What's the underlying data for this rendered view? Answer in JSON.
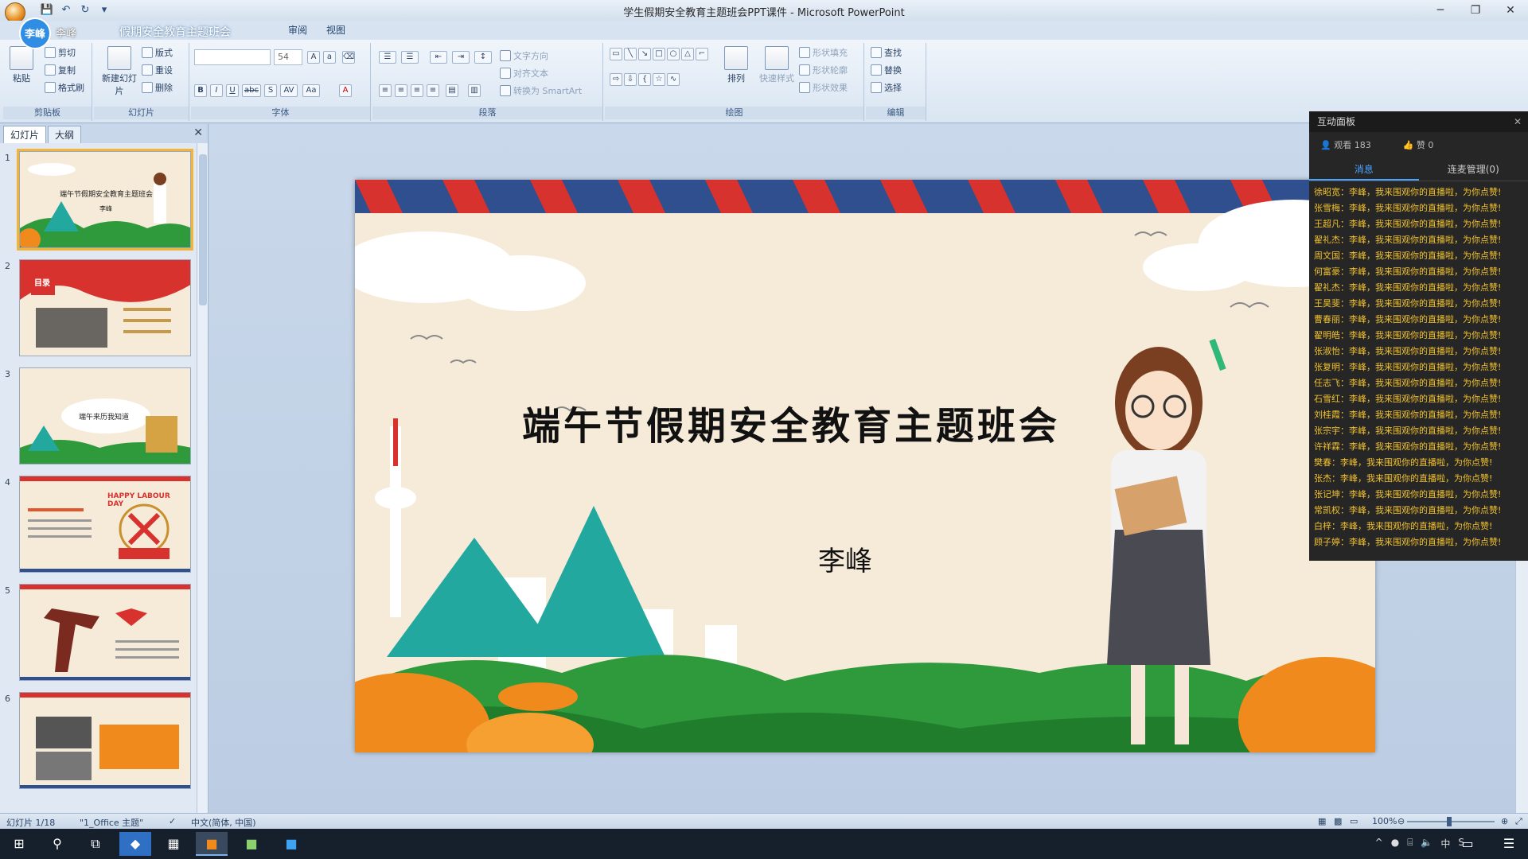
{
  "window": {
    "title": "学生假期安全教育主题班会PPT课件 - Microsoft PowerPoint",
    "min": "─",
    "max": "❐",
    "close": "✕"
  },
  "user": {
    "badge": "李峰",
    "name": "李峰"
  },
  "doc_tab_title": "假期安全教育主题班会",
  "ribbon_tabs": [
    "审阅",
    "视图"
  ],
  "ribbon": {
    "clipboard": {
      "label": "剪贴板",
      "paste": "粘贴",
      "cut": "剪切",
      "copy": "复制",
      "format_painter": "格式刷"
    },
    "slides": {
      "label": "幻灯片",
      "new_slide": "新建幻灯片",
      "layout": "版式",
      "reset": "重设",
      "delete": "删除"
    },
    "font": {
      "label": "字体",
      "size": "54",
      "bold": "B",
      "italic": "I",
      "underline": "U",
      "strike": "abc",
      "shadow": "S",
      "spacing": "AV",
      "case": "Aa",
      "color": "A"
    },
    "paragraph": {
      "label": "段落",
      "text_direction": "文字方向",
      "align_text": "对齐文本",
      "smartart": "转换为 SmartArt"
    },
    "drawing": {
      "label": "绘图",
      "arrange": "排列",
      "quick_styles": "快速样式",
      "shape_fill": "形状填充",
      "shape_outline": "形状轮廓",
      "shape_effects": "形状效果"
    },
    "editing": {
      "label": "编辑",
      "find": "查找",
      "replace": "替换",
      "select": "选择"
    }
  },
  "slides_pane": {
    "tab_slides": "幻灯片",
    "tab_outline": "大纲",
    "close": "✕",
    "thumbs": [
      {
        "num": "1",
        "title": "端午节假期安全教育主题班会",
        "name": "李峰"
      },
      {
        "num": "2",
        "title": "目录",
        "name": ""
      },
      {
        "num": "3",
        "title": "端午来历我知道",
        "name": ""
      },
      {
        "num": "4",
        "title": "HAPPY LABOUR DAY",
        "name": ""
      },
      {
        "num": "5",
        "title": "",
        "name": ""
      },
      {
        "num": "6",
        "title": "",
        "name": ""
      }
    ]
  },
  "slide": {
    "title": "端午节假期安全教育主题班会",
    "author": "李峰"
  },
  "interaction": {
    "title": "互动面板",
    "close": "✕",
    "viewers": "观看 183",
    "likes": "赞 0",
    "tab_messages": "消息",
    "tab_connect": "连麦管理(0)",
    "messages": [
      "徐昭宽：李峰，我来围观你的直播啦，为你点赞!",
      "张雪梅：李峰，我来围观你的直播啦，为你点赞!",
      "王超凡：李峰，我来围观你的直播啦，为你点赞!",
      "翟礼杰：李峰，我来围观你的直播啦，为你点赞!",
      "周文国：李峰，我来围观你的直播啦，为你点赞!",
      "何富豪：李峰，我来围观你的直播啦，为你点赞!",
      "翟礼杰：李峰，我来围观你的直播啦，为你点赞!",
      "王昊斐：李峰，我来围观你的直播啦，为你点赞!",
      "曹春丽：李峰，我来围观你的直播啦，为你点赞!",
      "翟明皓：李峰，我来围观你的直播啦，为你点赞!",
      "张淑怡：李峰，我来围观你的直播啦，为你点赞!",
      "张复明：李峰，我来围观你的直播啦，为你点赞!",
      "任志飞：李峰，我来围观你的直播啦，为你点赞!",
      "石雪红：李峰，我来围观你的直播啦，为你点赞!",
      "刘桂霞：李峰，我来围观你的直播啦，为你点赞!",
      "张宗宇：李峰，我来围观你的直播啦，为你点赞!",
      "许祥霖：李峰，我来围观你的直播啦，为你点赞!",
      "樊春：李峰，我来围观你的直播啦，为你点赞!",
      "张杰：李峰，我来围观你的直播啦，为你点赞!",
      "张记坤：李峰，我来围观你的直播啦，为你点赞!",
      "常凯权：李峰，我来围观你的直播啦，为你点赞!",
      "白梓：李峰，我来围观你的直播啦，为你点赞!",
      "顾子婷：李峰，我来围观你的直播啦，为你点赞!"
    ]
  },
  "status": {
    "slide_count": "幻灯片 1/18",
    "theme": "\"1_Office 主题\"",
    "language": "中文(简体, 中国)",
    "zoom": "100%"
  },
  "colors": {
    "accent": "#2f8de4",
    "slide_bg": "#f6ebd9",
    "stripe_red": "#d8322e",
    "stripe_blue": "#2f4f8e",
    "grass_green": "#2f9a3c",
    "teal_mountain": "#23a8a0",
    "orange_bush": "#f08a1c",
    "message_text": "#f2c230"
  }
}
